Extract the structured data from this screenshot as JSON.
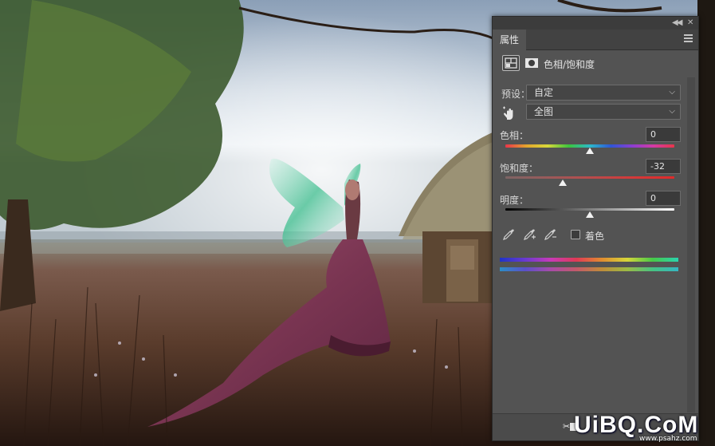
{
  "panel": {
    "tab_label": "属性",
    "header_title": "色相/饱和度",
    "preset_label": "预设：",
    "preset_value": "自定",
    "channel_value": "全图",
    "hue_label": "色相：",
    "hue_value": "0",
    "saturation_label": "饱和度：",
    "saturation_value": "-32",
    "lightness_label": "明度：",
    "lightness_value": "0",
    "colorize_label": "着色"
  },
  "sliders": {
    "hue": {
      "min": -180,
      "max": 180,
      "value": 0
    },
    "saturation": {
      "min": -100,
      "max": 100,
      "value": -32
    },
    "lightness": {
      "min": -100,
      "max": 100,
      "value": 0
    }
  },
  "icons": {
    "collapse": "double-chevron-left-icon",
    "close": "close-icon",
    "menu": "hamburger-menu-icon",
    "adjustment": "hue-saturation-adjustment-icon",
    "mask": "layer-mask-icon",
    "target_adjust": "hand-target-adjust-icon",
    "eyedroppers": [
      "eyedropper-icon",
      "eyedropper-plus-icon",
      "eyedropper-minus-icon"
    ]
  },
  "watermark": {
    "logo": "UiBQ.CoM",
    "url": "www.psahz.com"
  },
  "colors": {
    "panel_bg": "#535353",
    "tab_bar_bg": "#424242",
    "field_bg": "#454545",
    "text": "#d6d6d6"
  }
}
